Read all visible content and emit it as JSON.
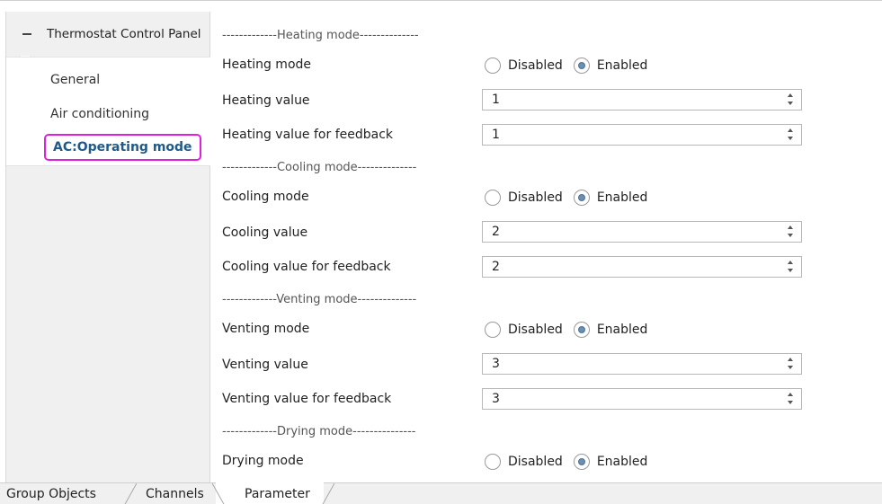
{
  "sidebar": {
    "title": "Thermostat Control Panel",
    "items": [
      {
        "label": "General"
      },
      {
        "label": "Air conditioning"
      },
      {
        "label": "AC:Operating mode"
      }
    ]
  },
  "content": {
    "heating": {
      "section": "-------------Heating mode--------------",
      "mode_label": "Heating mode",
      "disabled": "Disabled",
      "enabled": "Enabled",
      "value_label": "Heating value",
      "value": "1",
      "feedback_label": "Heating value for feedback",
      "feedback_value": "1"
    },
    "cooling": {
      "section": "-------------Cooling mode--------------",
      "mode_label": "Cooling mode",
      "disabled": "Disabled",
      "enabled": "Enabled",
      "value_label": "Cooling value",
      "value": "2",
      "feedback_label": "Cooling value for feedback",
      "feedback_value": "2"
    },
    "venting": {
      "section": "-------------Venting mode--------------",
      "mode_label": "Venting mode",
      "disabled": "Disabled",
      "enabled": "Enabled",
      "value_label": "Venting value",
      "value": "3",
      "feedback_label": "Venting value for feedback",
      "feedback_value": "3"
    },
    "drying": {
      "section": "-------------Drying mode---------------",
      "mode_label": "Drying mode",
      "disabled": "Disabled",
      "enabled": "Enabled"
    }
  },
  "tabs": [
    {
      "label": "Group Objects"
    },
    {
      "label": "Channels"
    },
    {
      "label": "Parameter"
    }
  ]
}
